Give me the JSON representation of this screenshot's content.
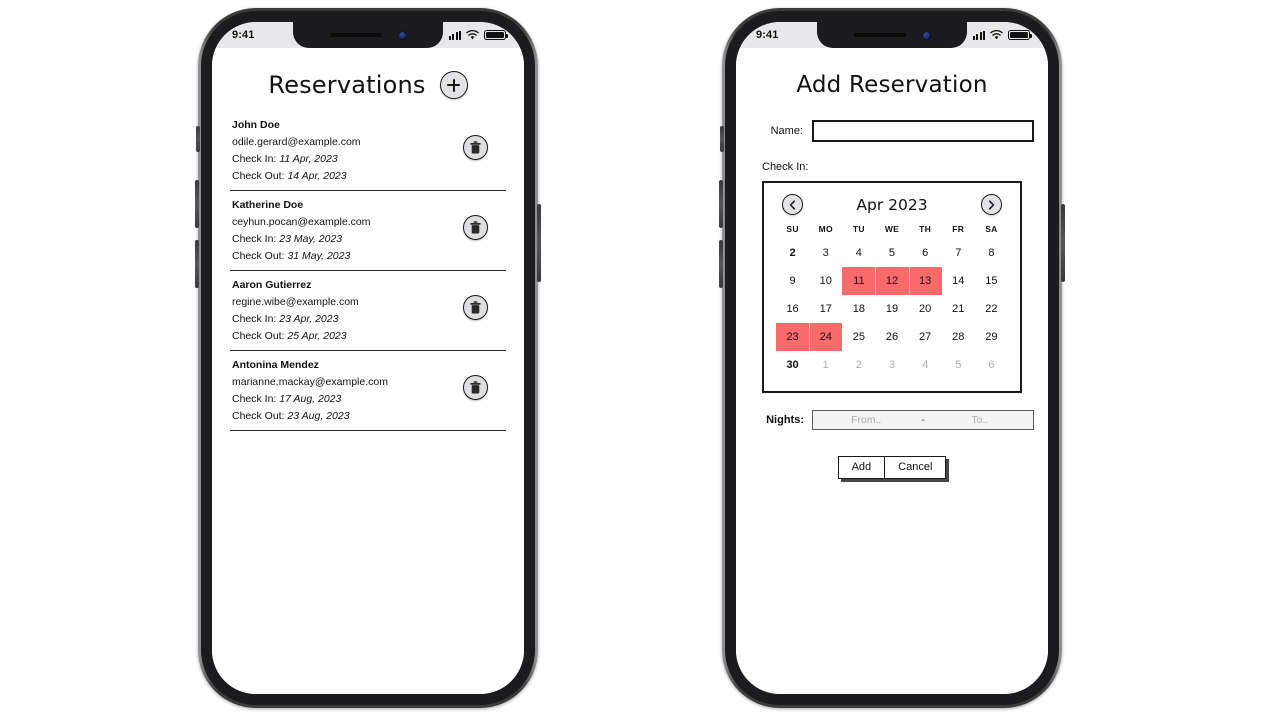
{
  "colors": {
    "accent_selected": "#fa6a6a",
    "frame": "#1c1c1e",
    "statusbar_bg": "#e8e8ea",
    "text": "#111111",
    "muted_day": "#b0b0b0"
  },
  "phone_list": {
    "status_bar": {
      "time": "9:41",
      "signal_icon": "cellular-signal-icon",
      "wifi_icon": "wifi-icon",
      "battery_icon": "battery-icon"
    },
    "header": {
      "title": "Reservations",
      "add_button_label": "+"
    },
    "reservations": [
      {
        "name": "John Doe",
        "email": "odile.gerard@example.com",
        "check_in_label": "Check In:",
        "check_in": "11 Apr, 2023",
        "check_out_label": "Check Out:",
        "check_out": "14 Apr, 2023"
      },
      {
        "name": "Katherine Doe",
        "email": "ceyhun.pocan@example.com",
        "check_in_label": "Check In:",
        "check_in": "23 May, 2023",
        "check_out_label": "Check Out:",
        "check_out": "31 May, 2023"
      },
      {
        "name": "Aaron Gutierrez",
        "email": "regine.wibe@example.com",
        "check_in_label": "Check In:",
        "check_in": "23 Apr, 2023",
        "check_out_label": "Check Out:",
        "check_out": "25 Apr, 2023"
      },
      {
        "name": "Antonina Mendez",
        "email": "marianne.mackay@example.com",
        "check_in_label": "Check In:",
        "check_in": "17 Aug, 2023",
        "check_out_label": "Check Out:",
        "check_out": "23 Aug, 2023"
      }
    ]
  },
  "phone_form": {
    "status_bar": {
      "time": "9:41",
      "signal_icon": "cellular-signal-icon",
      "wifi_icon": "wifi-icon",
      "battery_icon": "battery-icon"
    },
    "title": "Add Reservation",
    "name_field": {
      "label": "Name:",
      "value": "",
      "placeholder": ""
    },
    "check_in_section_label": "Check In:",
    "calendar": {
      "prev_icon": "chevron-left-icon",
      "next_icon": "chevron-right-icon",
      "month": "Apr 2023",
      "weekdays": [
        "SU",
        "MO",
        "TU",
        "WE",
        "TH",
        "FR",
        "SA"
      ],
      "weeks": [
        [
          {
            "day": "2",
            "state": "bold"
          },
          {
            "day": "3",
            "state": "normal"
          },
          {
            "day": "4",
            "state": "normal"
          },
          {
            "day": "5",
            "state": "normal"
          },
          {
            "day": "6",
            "state": "normal"
          },
          {
            "day": "7",
            "state": "normal"
          },
          {
            "day": "8",
            "state": "normal"
          }
        ],
        [
          {
            "day": "9",
            "state": "normal"
          },
          {
            "day": "10",
            "state": "normal"
          },
          {
            "day": "11",
            "state": "selected"
          },
          {
            "day": "12",
            "state": "selected"
          },
          {
            "day": "13",
            "state": "selected"
          },
          {
            "day": "14",
            "state": "normal"
          },
          {
            "day": "15",
            "state": "normal"
          }
        ],
        [
          {
            "day": "16",
            "state": "normal"
          },
          {
            "day": "17",
            "state": "normal"
          },
          {
            "day": "18",
            "state": "normal"
          },
          {
            "day": "19",
            "state": "normal"
          },
          {
            "day": "20",
            "state": "normal"
          },
          {
            "day": "21",
            "state": "normal"
          },
          {
            "day": "22",
            "state": "normal"
          }
        ],
        [
          {
            "day": "23",
            "state": "selected"
          },
          {
            "day": "24",
            "state": "selected"
          },
          {
            "day": "25",
            "state": "normal"
          },
          {
            "day": "26",
            "state": "normal"
          },
          {
            "day": "27",
            "state": "normal"
          },
          {
            "day": "28",
            "state": "normal"
          },
          {
            "day": "29",
            "state": "normal"
          }
        ],
        [
          {
            "day": "30",
            "state": "bold"
          },
          {
            "day": "1",
            "state": "muted"
          },
          {
            "day": "2",
            "state": "muted"
          },
          {
            "day": "3",
            "state": "muted"
          },
          {
            "day": "4",
            "state": "muted"
          },
          {
            "day": "5",
            "state": "muted"
          },
          {
            "day": "6",
            "state": "muted"
          }
        ]
      ]
    },
    "nights": {
      "label": "Nights:",
      "from_placeholder": "From..",
      "separator": "-",
      "to_placeholder": "To..",
      "from_value": "",
      "to_value": ""
    },
    "buttons": {
      "add": "Add",
      "cancel": "Cancel"
    }
  }
}
